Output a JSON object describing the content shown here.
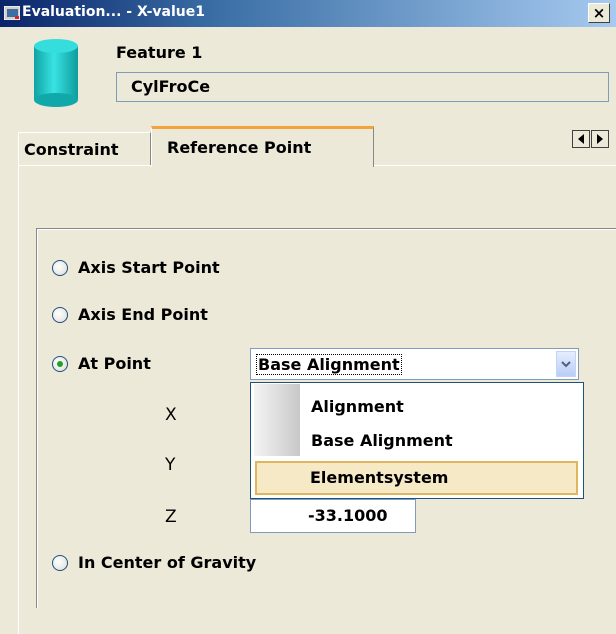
{
  "window": {
    "title": "Evaluation... - X-value1",
    "close_label": "×"
  },
  "feature": {
    "label": "Feature 1",
    "value": "CylFroCe"
  },
  "tabs": [
    {
      "label": "Constraint"
    },
    {
      "label": "Reference Point"
    }
  ],
  "radios": {
    "axis_start": "Axis Start Point",
    "axis_end": "Axis End Point",
    "at_point": "At Point",
    "center_gravity": "In Center of Gravity",
    "selected": "at_point"
  },
  "coords": {
    "x": "X",
    "y": "Y",
    "z": "Z",
    "z_value": "-33.1000"
  },
  "select": {
    "value": "Base Alignment",
    "options": [
      "Alignment",
      "Base Alignment",
      "Elementsystem"
    ],
    "highlighted": "Elementsystem"
  },
  "colors": {
    "accent_tab": "#F3A33C",
    "highlight_bg": "#F6E9C6",
    "radio_dot": "#21A121"
  }
}
